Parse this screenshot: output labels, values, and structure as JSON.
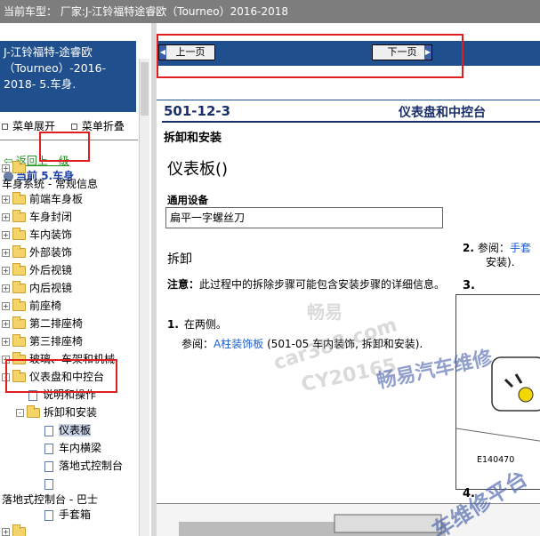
{
  "window": {
    "title": "当前车型：  厂家:J-江铃福特途睿欧（Tourneo）2016-2018"
  },
  "left_pane": {
    "vehicle_title": "J-江铃福特-途睿欧（Tourneo）-2016-2018- 5.车身.",
    "menu_expand": "菜单展开",
    "menu_collapse": "菜单折叠",
    "back_link": "返回上一级",
    "current_label": "当前",
    "current_value": "5.车身",
    "tree": [
      {
        "type": "folder",
        "label": "",
        "toggle": "+"
      },
      {
        "type": "text",
        "label": "车身系统 - 常规信息"
      },
      {
        "type": "folder",
        "label": "前端车身板",
        "toggle": "+"
      },
      {
        "type": "folder",
        "label": "车身封闭",
        "toggle": "+"
      },
      {
        "type": "folder",
        "label": "车内装饰",
        "toggle": "+"
      },
      {
        "type": "folder",
        "label": "外部装饰",
        "toggle": "+"
      },
      {
        "type": "folder",
        "label": "外后视镜",
        "toggle": "+"
      },
      {
        "type": "folder",
        "label": "内后视镜",
        "toggle": "+"
      },
      {
        "type": "folder",
        "label": "前座椅",
        "toggle": "+"
      },
      {
        "type": "folder",
        "label": "第二排座椅",
        "toggle": "+"
      },
      {
        "type": "folder",
        "label": "第三排座椅",
        "toggle": "+"
      },
      {
        "type": "folder",
        "label": "玻璃、车架和机械",
        "toggle": "+"
      },
      {
        "type": "folder",
        "label": "仪表盘和中控台",
        "toggle": "-"
      },
      {
        "type": "doc",
        "label": "说明和操作"
      },
      {
        "type": "folder",
        "label": "拆卸和安装",
        "toggle": "-"
      },
      {
        "type": "doc",
        "label": "仪表板",
        "selected": true
      },
      {
        "type": "doc",
        "label": "车内横梁"
      },
      {
        "type": "doc",
        "label": "落地式控制台"
      },
      {
        "type": "doc",
        "label": ""
      },
      {
        "type": "text",
        "label": "落地式控制台 - 巴士"
      },
      {
        "type": "doc",
        "label": "手套箱"
      },
      {
        "type": "folder",
        "label": "",
        "toggle": "+"
      }
    ]
  },
  "right_pane": {
    "prev_button": "上一页",
    "next_button": "下一页",
    "section_code": "501-12-3",
    "section_name": "仪表盘和中控台",
    "procedure_type": "拆卸和安装",
    "doc_title": "仪表板()",
    "tools_label": "通用设备",
    "tools_item": "扁平一字螺丝刀",
    "removal_heading": "拆卸",
    "note_label": "注意：",
    "note_text": "此过程中的拆除步骤可能包含安装步骤的详细信息。",
    "step1_num": "1.",
    "step1_text": "在两侧。",
    "step1_ref_prefix": "参阅：",
    "step1_ref_link": "A柱装饰板",
    "step1_ref_suffix": "(501-05 车内装饰, 拆卸和安装).",
    "step2_num": "2.",
    "step2_ref_prefix": "参阅：",
    "step2_ref_link": "手套",
    "step2_ref_suffix": "安装).",
    "step3_num": "3.",
    "figure_id": "E140470",
    "step4_num": "4."
  },
  "watermarks": {
    "w1": "畅易",
    "w2": "car388.com",
    "w3": "CY20165",
    "w4": "畅易汽车维修",
    "w5": "车维修平台"
  },
  "colors": {
    "title_bar": "#7d7d7d",
    "nav_blue": "#1f4f8c",
    "highlight_red": "#e02020",
    "link_blue": "#1b5fd0",
    "heading_navy": "#1a2f6a"
  }
}
